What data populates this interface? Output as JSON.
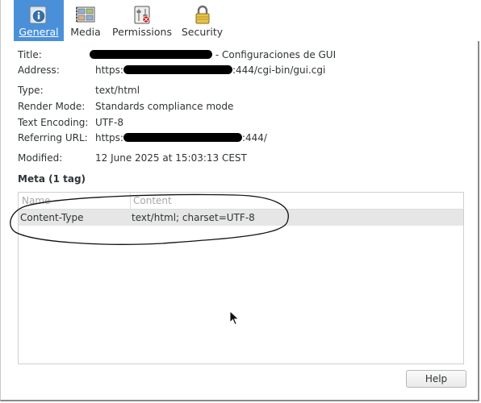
{
  "tabs": [
    {
      "label": "General",
      "icon": "info-icon",
      "active": true
    },
    {
      "label": "Media",
      "icon": "media-icon",
      "active": false
    },
    {
      "label": "Permissions",
      "icon": "permissions-icon",
      "active": false
    },
    {
      "label": "Security",
      "icon": "lock-icon",
      "active": false
    }
  ],
  "general": {
    "title_label": "Title:",
    "title_value": "- Configuraciones de GUI",
    "address_label": "Address:",
    "address_prefix": "https:",
    "address_suffix": ":444/cgi-bin/gui.cgi",
    "type_label": "Type:",
    "type_value": "text/html",
    "render_label": "Render Mode:",
    "render_value": "Standards compliance mode",
    "encoding_label": "Text Encoding:",
    "encoding_value": "UTF-8",
    "referring_label": "Referring URL:",
    "referring_prefix": "https:",
    "referring_suffix": ":444/",
    "modified_label": "Modified:",
    "modified_value": "12 June 2025 at 15:03:13 CEST"
  },
  "meta": {
    "heading": "Meta (1 tag)",
    "columns": [
      "Name",
      "Content"
    ],
    "rows": [
      {
        "name": "Content-Type",
        "content": "text/html; charset=UTF-8"
      }
    ]
  },
  "footer": {
    "help_label": "Help"
  },
  "colors": {
    "active_tab": "#4a90d9",
    "selected_row": "#e6e6e6",
    "redaction": "#000000"
  }
}
